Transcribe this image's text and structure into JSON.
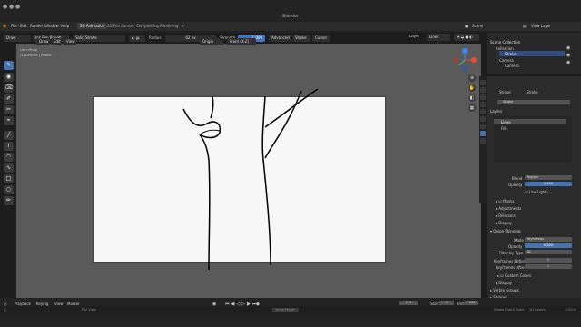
{
  "app_title": "Blender",
  "menu": [
    "File",
    "Edit",
    "Render",
    "Window",
    "Help"
  ],
  "workspace_tabs": [
    "2D Animation",
    "2D Full Canvas",
    "Compositing",
    "Rendering"
  ],
  "top_right": {
    "scene": "Scene",
    "view_layer": "View Layer"
  },
  "tool_header": {
    "mode": "Draw",
    "brush": "Ink Pen Rough",
    "material": "Solid Stroke",
    "radius_label": "Radius",
    "radius": "62 px",
    "strength_label": "Strength",
    "strength": "1.000",
    "advanced": "Advanced",
    "stroke": "Stroke",
    "cursor": "Cursor"
  },
  "viewport_header": {
    "draw": "Draw",
    "edit": "Edit",
    "view": "View",
    "origin": "Origin",
    "front": "Front (X-Z)",
    "layer_label": "Layer",
    "layer": "Lines"
  },
  "viewport_info": {
    "line1": "User Persp",
    "line2": "(1) GPencil | Stroke"
  },
  "outliner": {
    "root": "Scene Collection",
    "items": [
      {
        "label": "Collection"
      },
      {
        "label": "Stroke"
      },
      {
        "label": "Camera"
      },
      {
        "label": "Camera"
      }
    ]
  },
  "properties": {
    "object_name": "Stroke",
    "data_name": "Stroke",
    "layers_section": "Layers",
    "layers": [
      {
        "name": "Lines"
      },
      {
        "name": "Fills"
      }
    ],
    "blend_label": "Blend",
    "blend": "Regular",
    "opacity_label": "Opacity",
    "opacity": "1.000",
    "use_lights": "Use Lights",
    "masks": "Masks",
    "adjustments": "Adjustments",
    "relations": "Relations",
    "display": "Display",
    "onion_section": "Onion Skinning",
    "mode_label": "Mode",
    "mode": "Keyframes",
    "onion_opacity_label": "Opacity",
    "onion_opacity": "0.500",
    "filter_label": "Filter by Type",
    "filter": "All",
    "kf_before_label": "Keyframes Before",
    "kf_before": "1",
    "kf_after_label": "Keyframes After",
    "kf_after": "1",
    "custom_colors": "Custom Colors",
    "display2": "Display",
    "vertex_groups": "Vertex Groups",
    "strokes": "Strokes"
  },
  "timeline": {
    "playback": "Playback",
    "keying": "Keying",
    "view": "View",
    "marker": "Marker",
    "current": "115",
    "start_label": "Start",
    "start": "1",
    "end_label": "End",
    "end": "1000"
  },
  "status": {
    "left": "Pan View",
    "right": "Stroke Depth Order",
    "layers": "2D Layers",
    "version": "2.83.0",
    "popup": "Anim Player"
  }
}
